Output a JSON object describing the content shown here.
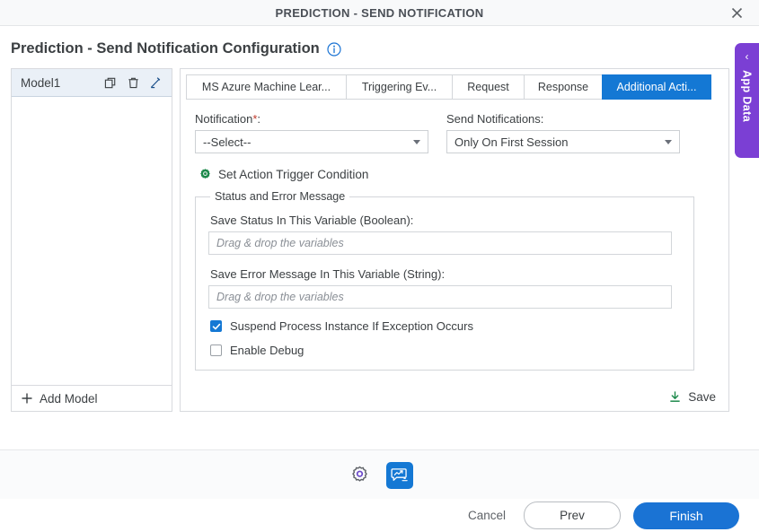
{
  "window": {
    "title": "PREDICTION - SEND NOTIFICATION",
    "close_icon": "close-icon"
  },
  "page": {
    "title": "Prediction - Send Notification Configuration",
    "info_icon": "info-circle-icon"
  },
  "models": {
    "items": [
      {
        "name": "Model1",
        "copy_icon": "copy-icon",
        "delete_icon": "trash-icon",
        "edit_icon": "pencil-icon"
      }
    ],
    "add_label": "Add Model",
    "add_icon": "plus-icon"
  },
  "tabs": [
    {
      "label": "MS Azure Machine Lear...",
      "active": false
    },
    {
      "label": "Triggering Ev...",
      "active": false
    },
    {
      "label": "Request",
      "active": false
    },
    {
      "label": "Response",
      "active": false
    },
    {
      "label": "Additional Acti...",
      "active": true
    }
  ],
  "form": {
    "notification": {
      "label": "Notification",
      "required_mark": "*",
      "label_suffix": ":",
      "value": "--Select--"
    },
    "send_notifications": {
      "label": "Send Notifications:",
      "value": "Only On First Session"
    },
    "trigger_condition": {
      "label": "Set Action Trigger Condition",
      "icon": "gear-icon",
      "icon_color": "#1e8a4c"
    },
    "group": {
      "legend": "Status and Error Message",
      "status_variable": {
        "label": "Save Status In This Variable (Boolean):",
        "value": "",
        "placeholder": "Drag & drop the variables"
      },
      "error_variable": {
        "label": "Save Error Message In This Variable (String):",
        "value": "",
        "placeholder": "Drag & drop the variables"
      },
      "suspend": {
        "label": "Suspend Process Instance If Exception Occurs",
        "checked": true
      },
      "enable_debug": {
        "label": "Enable Debug",
        "checked": false
      }
    },
    "save": {
      "label": "Save",
      "icon": "download-icon",
      "icon_color": "#1e8a4c"
    }
  },
  "app_data_tab": {
    "label": "App Data",
    "chevron": "‹",
    "color": "#7b3fd4"
  },
  "icon_bar": {
    "settings": {
      "icon": "gear-icon",
      "color": "#6a48c9",
      "selected": false
    },
    "prediction": {
      "icon": "prediction-bubble-icon",
      "color": "#1478d4",
      "selected": true
    }
  },
  "footer": {
    "cancel": "Cancel",
    "prev": "Prev",
    "finish": "Finish"
  },
  "colors": {
    "accent_blue": "#1478d4",
    "purple": "#7b3fd4",
    "green": "#1e8a4c",
    "required_red": "#c0392b"
  }
}
